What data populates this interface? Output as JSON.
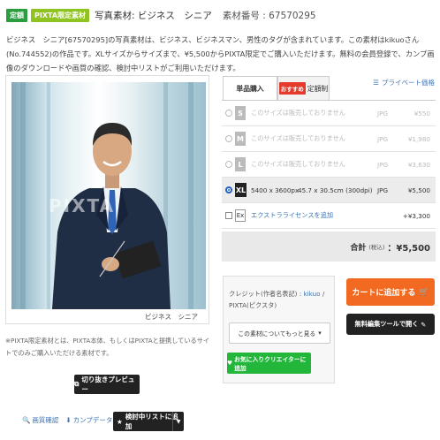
{
  "header": {
    "badge_fixed": "定額",
    "badge_limited": "PIXTA限定素材",
    "title": "写真素材: ビジネス　シニア",
    "material_id": "素材番号 : 67570295"
  },
  "description": "ビジネス　シニア[67570295]の写真素材は、ビジネス、ビジネスマン、男性のタグが含まれています。この素材はkikuoさん(No.744552)の作品です。XLサイズからサイズまで、¥5,500からPIXTA限定でご購入いただけます。無料の会員登録で、カンプ画像のダウンロードや画質の確認、検討中リストがご利用いただけます。",
  "photo": {
    "watermark": "PIXTA",
    "caption": "ビジネス　シニア"
  },
  "footnote": "※PIXTA限定素材とは、PIXTA本体、もしくはPIXTAと提携しているサイトでのみご購入いただける素材です。",
  "buttons": {
    "crop_preview": "切り抜きプレビュー",
    "compare_list": "検討中リストに追加",
    "more_about": "この素材についてもっと見る",
    "favorite_creator": "お気に入りクリエイターに追加",
    "add_to_cart": "カートに追加する",
    "edit_tool": "無料編集ツールで開く"
  },
  "links": {
    "quality": "画質確認",
    "comp": "カンプデータ",
    "private_price": "プライベート価格"
  },
  "tabs": {
    "single": "単品購入",
    "recommend": "おすすめ",
    "subscription": "定額制"
  },
  "sizes": [
    {
      "code": "S",
      "info": "このサイズは販売しておりません",
      "dim": "",
      "format": "JPG",
      "price": "¥550"
    },
    {
      "code": "M",
      "info": "このサイズは販売しておりません",
      "dim": "",
      "format": "JPG",
      "price": "¥1,980"
    },
    {
      "code": "L",
      "info": "このサイズは販売しておりません",
      "dim": "",
      "format": "JPG",
      "price": "¥3,630"
    },
    {
      "code": "XL",
      "info": "5400 x 3600px",
      "dim": "45.7 x 30.5cm (300dpi)",
      "format": "JPG",
      "price": "¥5,500"
    }
  ],
  "extra_license": {
    "code": "Ex",
    "label": "エクストラライセンスを追加",
    "price": "+¥3,300"
  },
  "total": {
    "label": "合計",
    "tax": "(税込)",
    "value": "：¥5,500"
  },
  "credit": {
    "prefix": "クレジット(作者名表記) : ",
    "author": "kikuo",
    "suffix": " / PIXTA(ピクスタ)"
  },
  "colors": {
    "badge_fixed": "#2a9d3e",
    "badge_limited": "#8fc31f",
    "cart": "#f26a21",
    "favorite": "#22b63a",
    "link": "#3b73b3",
    "recommend": "#e53b2c"
  }
}
